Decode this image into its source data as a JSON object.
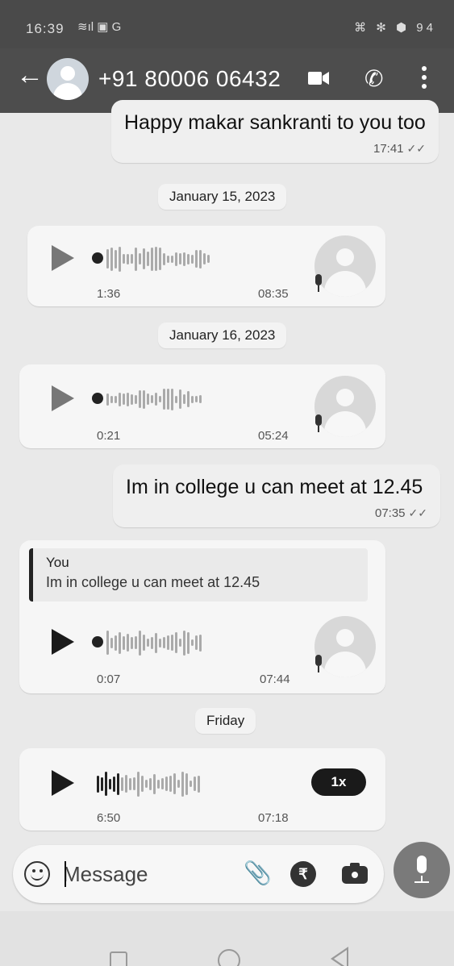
{
  "status_bar": {
    "time": "16:39",
    "signal": "≋ıl ▣ G",
    "right_icons": "⌘ ✻ ⬢ 94"
  },
  "header": {
    "contact_name": "+91 80006 06432",
    "icons": [
      "back-arrow-icon",
      "avatar",
      "video-call-icon",
      "phone-icon",
      "more-vert-icon"
    ]
  },
  "messages": {
    "m1": {
      "text": "Happy makar sankranti to you too",
      "time": "17:41",
      "tick": "✓✓"
    },
    "date1": "January 15, 2023",
    "v1": {
      "duration": "1:36",
      "time": "08:35"
    },
    "date2": "January 16, 2023",
    "v2": {
      "duration": "0:21",
      "time": "05:24"
    },
    "m2": {
      "text": "Im in college u can meet at 12.45",
      "time": "07:35",
      "tick": "✓✓"
    },
    "v3": {
      "quote_author": "You",
      "quote_text": "Im in college u can meet at 12.45",
      "duration": "0:07",
      "time": "07:44"
    },
    "date3": "Friday",
    "v4": {
      "duration": "6:50",
      "time": "07:18",
      "speed": "1x"
    }
  },
  "composer": {
    "placeholder": "Message",
    "rupee": "₹",
    "clip": "📎"
  },
  "colors": {
    "header_bg": "#4d4d4d",
    "chat_bg": "#e9e9e9",
    "bubble_bg": "#f6f6f6",
    "mic_button": "#7a7a7a"
  }
}
